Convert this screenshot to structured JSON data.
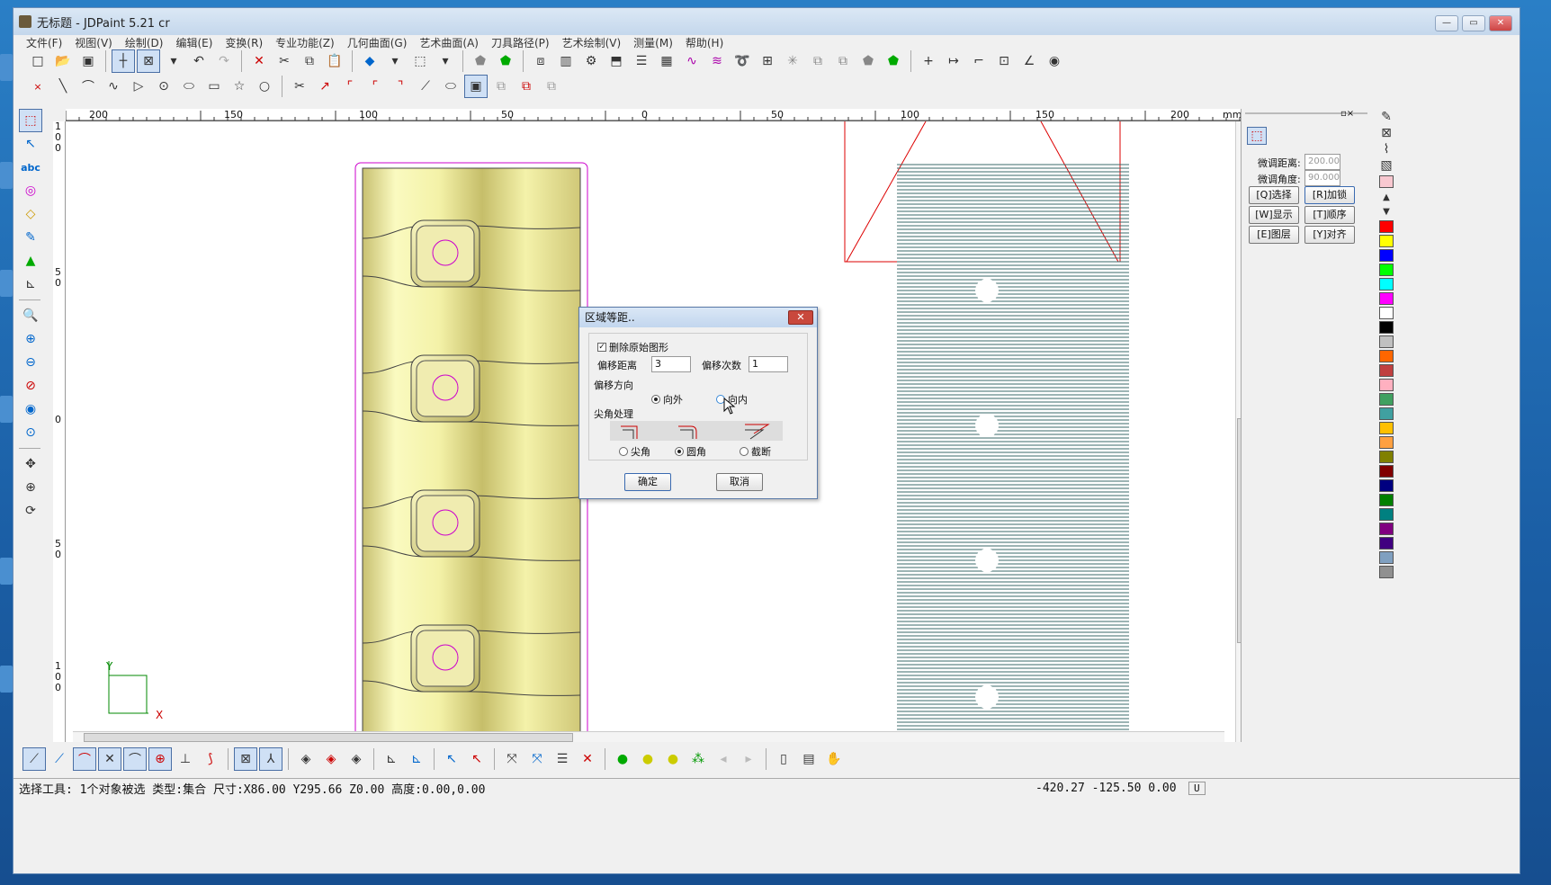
{
  "window": {
    "title": "无标题 - JDPaint 5.21 cr",
    "min_label": "—",
    "max_label": "▭",
    "close_label": "✕"
  },
  "menu": [
    "文件(F)",
    "视图(V)",
    "绘制(D)",
    "编辑(E)",
    "变换(R)",
    "专业功能(Z)",
    "几何曲面(G)",
    "艺术曲面(A)",
    "刀具路径(P)",
    "艺术绘制(V)",
    "测量(M)",
    "帮助(H)"
  ],
  "ruler": {
    "top_labels": [
      "200",
      "150",
      "100",
      "50",
      "0",
      "50",
      "100",
      "150",
      "200"
    ],
    "unit": "mm",
    "left_labels": [
      "1\n0\n0",
      "5\n0",
      "0",
      "5\n0",
      "1\n0\n0"
    ]
  },
  "axes": {
    "x_label": "X",
    "y_label": "Y"
  },
  "right_panel": {
    "fine_distance_label": "微调距离:",
    "fine_distance_value": "200.00",
    "fine_angle_label": "微调角度:",
    "fine_angle_value": "90.000",
    "buttons": [
      "[Q]选择",
      "[R]加锁",
      "[W]显示",
      "[T]顺序",
      "[E]图层",
      "[Y]对齐"
    ]
  },
  "palette": [
    "#ff0000",
    "#ffff00",
    "#0000ff",
    "#00ff00",
    "#00ffff",
    "#ff00ff",
    "#ffffff",
    "#000000",
    "#c0c0c0",
    "#ff6600",
    "#c04040",
    "#ffb0c0",
    "#40a060",
    "#40a0a0",
    "#ffc000",
    "#ffa040",
    "#808000",
    "#800000",
    "#000080",
    "#008000",
    "#008080",
    "#800080",
    "#400080",
    "#80a0c0",
    "#909090"
  ],
  "dialog": {
    "title": "区域等距..",
    "delete_original_label": "删除原始图形",
    "offset_distance_label": "偏移距离",
    "offset_distance_value": "3",
    "offset_count_label": "偏移次数",
    "offset_count_value": "1",
    "direction_label": "偏移方向",
    "outward_label": "向外",
    "inward_label": "向内",
    "corner_label": "尖角处理",
    "sharp_label": "尖角",
    "round_label": "圆角",
    "cut_label": "截断",
    "ok_label": "确定",
    "cancel_label": "取消"
  },
  "status": {
    "left": "选择工具: 1个对象被选 类型:集合 尺寸:X86.00 Y295.66 Z0.00 高度:0.00,0.00",
    "coords": "-420.27 -125.50 0.00",
    "mode": "U"
  }
}
